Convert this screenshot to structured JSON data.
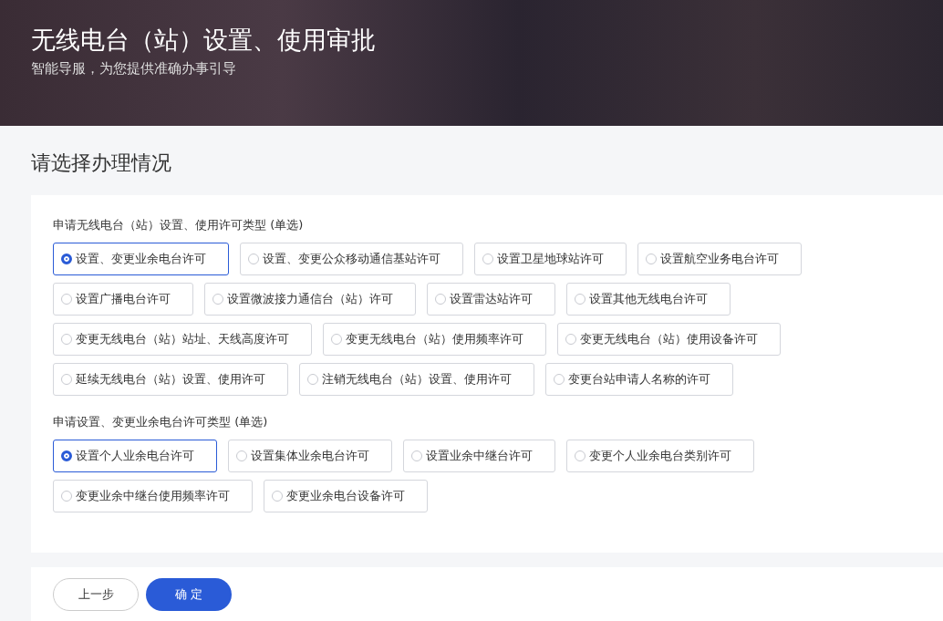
{
  "banner": {
    "title": "无线电台（站）设置、使用审批",
    "subtitle": "智能导服，为您提供准确办事引导"
  },
  "heading": "请选择办理情况",
  "groups": [
    {
      "label": "申请无线电台（站）设置、使用许可类型 (单选)",
      "rows": [
        [
          {
            "label": "设置、变更业余电台许可",
            "selected": true
          },
          {
            "label": "设置、变更公众移动通信基站许可",
            "selected": false
          },
          {
            "label": "设置卫星地球站许可",
            "selected": false
          },
          {
            "label": "设置航空业务电台许可",
            "selected": false
          }
        ],
        [
          {
            "label": "设置广播电台许可",
            "selected": false
          },
          {
            "label": "设置微波接力通信台（站）许可",
            "selected": false
          },
          {
            "label": "设置雷达站许可",
            "selected": false
          },
          {
            "label": "设置其他无线电台许可",
            "selected": false
          }
        ],
        [
          {
            "label": "变更无线电台（站）站址、天线高度许可",
            "selected": false
          },
          {
            "label": "变更无线电台（站）使用频率许可",
            "selected": false
          },
          {
            "label": "变更无线电台（站）使用设备许可",
            "selected": false
          }
        ],
        [
          {
            "label": "延续无线电台（站）设置、使用许可",
            "selected": false
          },
          {
            "label": "注销无线电台（站）设置、使用许可",
            "selected": false
          },
          {
            "label": "变更台站申请人名称的许可",
            "selected": false
          }
        ]
      ]
    },
    {
      "label": "申请设置、变更业余电台许可类型 (单选)",
      "rows": [
        [
          {
            "label": "设置个人业余电台许可",
            "selected": true
          },
          {
            "label": "设置集体业余电台许可",
            "selected": false
          },
          {
            "label": "设置业余中继台许可",
            "selected": false
          },
          {
            "label": "变更个人业余电台类别许可",
            "selected": false
          }
        ],
        [
          {
            "label": "变更业余中继台使用频率许可",
            "selected": false
          },
          {
            "label": "变更业余电台设备许可",
            "selected": false
          }
        ]
      ]
    }
  ],
  "buttons": {
    "back": "上一步",
    "confirm": "确 定"
  }
}
